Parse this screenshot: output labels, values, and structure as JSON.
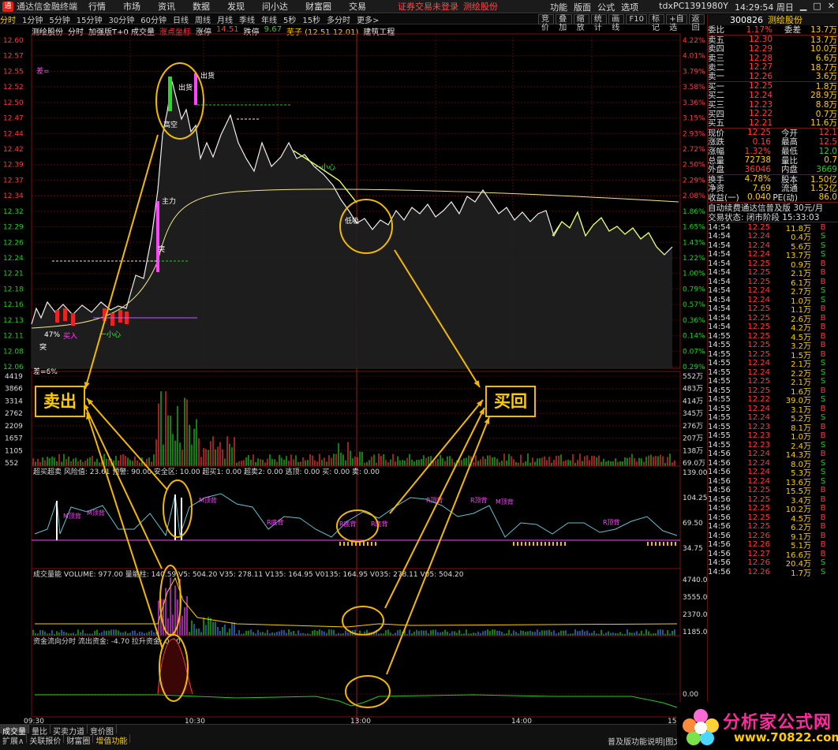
{
  "window": {
    "app_name": "通达信金融终端",
    "menu": [
      "行情",
      "市场",
      "资讯",
      "数据",
      "发现",
      "问小达",
      "财富圈",
      "交易"
    ],
    "warning": "证券交易未登录",
    "stock_label": "测绘股份",
    "right_menu": [
      "功能",
      "版面",
      "公式",
      "选项"
    ],
    "user": "tdxPC1391980Y",
    "clock": "14:29:54 周日"
  },
  "period_bar": {
    "items": [
      "分时",
      "1分钟",
      "5分钟",
      "15分钟",
      "30分钟",
      "60分钟",
      "日线",
      "周线",
      "月线",
      "季线",
      "年线",
      "5秒",
      "15秒",
      "多分时",
      "更多>"
    ],
    "active": "分时"
  },
  "side_toolbar": [
    "竞价",
    "叠加",
    "缩放",
    "统计",
    "画线",
    "F10",
    "标记",
    "+自选",
    "返回"
  ],
  "chart_header": {
    "stock": "测绘股份",
    "mode": "分时",
    "indicator": "加强版T+0 成交量",
    "tag": "涨点坐标",
    "up_limit_label": "涨停",
    "up_limit": "14.51",
    "down_limit_label": "跌停",
    "down_limit": "9.67",
    "extra": "芜子 (12.51 12.01)",
    "sector": "建筑工程"
  },
  "main_axis": {
    "left": [
      "12.60",
      "12.57",
      "12.55",
      "12.52",
      "12.50",
      "12.47",
      "12.44",
      "12.42",
      "12.39",
      "12.37",
      "12.34",
      "12.32",
      "12.29",
      "12.26",
      "12.24",
      "12.21",
      "12.18",
      "12.16",
      "12.13",
      "12.11",
      "12.08",
      "12.06"
    ],
    "right": [
      "4.22%",
      "4.01%",
      "3.79%",
      "3.58%",
      "3.36%",
      "3.15%",
      "2.93%",
      "2.72%",
      "2.50%",
      "2.29%",
      "2.08%",
      "1.86%",
      "1.65%",
      "1.43%",
      "1.22%",
      "1.00%",
      "0.79%",
      "0.57%",
      "0.36%",
      "0.14%",
      "0.07%",
      "0.29%"
    ]
  },
  "main_annotations": {
    "chu_huo_1": "出货",
    "chu_huo_2": "出货",
    "zhu_li": "主力",
    "tu": "突",
    "gao_kong": "高空",
    "xiao_xin_1": "一小心",
    "xiao_xin_2": "一小心",
    "mai_ru": "买入",
    "cha_label": "差=",
    "pct_label": "47%",
    "tu2": "突",
    "di_xi": "低吸",
    "bottom_label": "差=6%"
  },
  "volume_axis": {
    "left": [
      "4419",
      "3866",
      "3314",
      "2762",
      "2209",
      "1657",
      "1105",
      "552"
    ],
    "right": [
      "552万",
      "483万",
      "414万",
      "345万",
      "276万",
      "207万",
      "138万",
      "69.0万"
    ]
  },
  "indicator1": {
    "header": "超买超卖  风险值: 23.61  预警: 90.00  安全区: 10.00  超买1: 0.00  超卖2: 0.00  逃顶: 0.00  买: 0.00  卖: 0.00",
    "axis_right": [
      "139.00",
      "104.25",
      "69.50",
      "34.75"
    ],
    "labels": [
      "M顶背",
      "M顶背",
      "M顶背",
      "R底背",
      "R底背",
      "R底背",
      "R顶背",
      "M顶背",
      "R顶背",
      "R顶背"
    ]
  },
  "indicator2": {
    "header": "成交量能  VOLUME: 977.00  量能柱: 140.59  V5: 504.20  V35: 278.11  V135: 164.95  V0135: 164.95  V035: 278.11  V05: 504.20",
    "axis_right": [
      "4740.00",
      "3555.04",
      "2370.03",
      "1185.01"
    ]
  },
  "indicator3": {
    "header": "资金流向分时  流出资金: -4.70  拉升资金: 0.00",
    "axis_right": [
      "0.00"
    ]
  },
  "time_axis": [
    "09:30",
    "10:30",
    "13:00",
    "14:00",
    "15"
  ],
  "callouts": {
    "sell": "卖出",
    "buy": "买回"
  },
  "right_panel": {
    "code": "300826",
    "name": "测绘股份",
    "ratio_label": "委比",
    "ratio": "1.17%",
    "diff_label": "委差",
    "diff": "13.7万",
    "sells": [
      {
        "label": "卖五",
        "price": "12.30",
        "vol": "13.7万",
        "color": "red"
      },
      {
        "label": "卖四",
        "price": "12.29",
        "vol": "10.0万",
        "color": "red"
      },
      {
        "label": "卖三",
        "price": "12.28",
        "vol": "6.6万",
        "color": "red"
      },
      {
        "label": "卖二",
        "price": "12.27",
        "vol": "18.7万",
        "color": "red"
      },
      {
        "label": "卖一",
        "price": "12.26",
        "vol": "3.6万",
        "color": "red"
      }
    ],
    "buys": [
      {
        "label": "买一",
        "price": "12.25",
        "vol": "1.8万",
        "color": "red"
      },
      {
        "label": "买二",
        "price": "12.24",
        "vol": "28.9万",
        "color": "red"
      },
      {
        "label": "买三",
        "price": "12.23",
        "vol": "8.8万",
        "color": "red"
      },
      {
        "label": "买四",
        "price": "12.22",
        "vol": "0.7万",
        "color": "red"
      },
      {
        "label": "买五",
        "price": "12.21",
        "vol": "11.6万",
        "color": "red"
      }
    ],
    "stats": [
      {
        "l1": "现价",
        "v1": "12.25",
        "c1": "red",
        "l2": "今开",
        "v2": "12.1",
        "c2": "red"
      },
      {
        "l1": "涨跌",
        "v1": "0.16",
        "c1": "red",
        "l2": "最高",
        "v2": "12.5",
        "c2": "red"
      },
      {
        "l1": "涨幅",
        "v1": "1.32%",
        "c1": "red",
        "l2": "最低",
        "v2": "12.0",
        "c2": "green"
      },
      {
        "l1": "总量",
        "v1": "72738",
        "c1": "yellow",
        "l2": "量比",
        "v2": "0.7",
        "c2": "yellow"
      },
      {
        "l1": "外盘",
        "v1": "36046",
        "c1": "red",
        "l2": "内盘",
        "v2": "3669",
        "c2": "green"
      }
    ],
    "stats2": [
      {
        "l1": "换手",
        "v1": "4.78%",
        "c1": "yellow",
        "l2": "股本",
        "v2": "1.50亿",
        "c2": "yellow"
      },
      {
        "l1": "净资",
        "v1": "7.69",
        "c1": "yellow",
        "l2": "流通",
        "v2": "1.52亿",
        "c2": "yellow"
      },
      {
        "l1": "收益(一)",
        "v1": "0.040",
        "c1": "yellow",
        "l2": "PE(动)",
        "v2": "86.0",
        "c2": "yellow"
      }
    ],
    "notice": "自动续费通达信普及版 30元/月",
    "trade_state": "交易状态: 闭市阶段 15:33:03",
    "ticks": [
      [
        "14:54",
        "12.25",
        "11.8万",
        "B"
      ],
      [
        "14:54",
        "12.24",
        "0.4万",
        "S"
      ],
      [
        "14:54",
        "12.24",
        "5.6万",
        "S"
      ],
      [
        "14:54",
        "12.24",
        "13.7万",
        "S"
      ],
      [
        "14:54",
        "12.25",
        "0.9万",
        "B"
      ],
      [
        "14:54",
        "12.25",
        "2.1万",
        "B"
      ],
      [
        "14:54",
        "12.25",
        "6.1万",
        "B"
      ],
      [
        "14:54",
        "12.24",
        "2.7万",
        "S"
      ],
      [
        "14:54",
        "12.24",
        "1.0万",
        "S"
      ],
      [
        "14:54",
        "12.25",
        "1.1万",
        "B"
      ],
      [
        "14:54",
        "12.25",
        "2.6万",
        "B"
      ],
      [
        "14:54",
        "12.25",
        "4.2万",
        "B"
      ],
      [
        "14:55",
        "12.25",
        "4.5万",
        "B"
      ],
      [
        "14:55",
        "12.25",
        "3.2万",
        "B"
      ],
      [
        "14:55",
        "12.25",
        "1.5万",
        "B"
      ],
      [
        "14:55",
        "12.24",
        "2.1万",
        "S"
      ],
      [
        "14:55",
        "12.24",
        "2.2万",
        "S"
      ],
      [
        "14:55",
        "12.25",
        "2.1万",
        "S"
      ],
      [
        "14:55",
        "12.25",
        "1.6万",
        "B"
      ],
      [
        "14:55",
        "12.22",
        "39.0万",
        "S"
      ],
      [
        "14:55",
        "12.24",
        "3.1万",
        "B"
      ],
      [
        "14:55",
        "12.24",
        "5.2万",
        "S"
      ],
      [
        "14:55",
        "12.23",
        "8.1万",
        "B"
      ],
      [
        "14:55",
        "12.23",
        "1.0万",
        "B"
      ],
      [
        "14:55",
        "12.23",
        "2.4万",
        "S"
      ],
      [
        "14:56",
        "12.24",
        "14.3万",
        "B"
      ],
      [
        "14:56",
        "12.24",
        "8.0万",
        "S"
      ],
      [
        "14:56",
        "12.24",
        "5.3万",
        "S"
      ],
      [
        "14:56",
        "12.24",
        "13.6万",
        "S"
      ],
      [
        "14:56",
        "12.25",
        "15.5万",
        "B"
      ],
      [
        "14:56",
        "12.25",
        "3.4万",
        "B"
      ],
      [
        "14:56",
        "12.25",
        "10.2万",
        "B"
      ],
      [
        "14:56",
        "12.25",
        "4.5万",
        "B"
      ],
      [
        "14:56",
        "12.25",
        "6.2万",
        "B"
      ],
      [
        "14:56",
        "12.26",
        "9.1万",
        "B"
      ],
      [
        "14:56",
        "12.26",
        "5.1万",
        "B"
      ],
      [
        "14:56",
        "12.27",
        "16.6万",
        "B"
      ],
      [
        "14:56",
        "12.26",
        "20.4万",
        "S"
      ],
      [
        "14:56",
        "12.26",
        "1.7万",
        "S"
      ]
    ]
  },
  "bottom_tabs": {
    "row1": [
      "成交量",
      "量比",
      "买卖力道",
      "竞价图"
    ],
    "row1_active": "成交量",
    "row2": [
      "扩展∧",
      "关联报价",
      "财富圈",
      "增值功能"
    ],
    "row2_active": "增值功能",
    "right_text": "普及版功能说明|图文F"
  },
  "brand": {
    "name": "分析家公式网",
    "url": "www.70822.com"
  }
}
